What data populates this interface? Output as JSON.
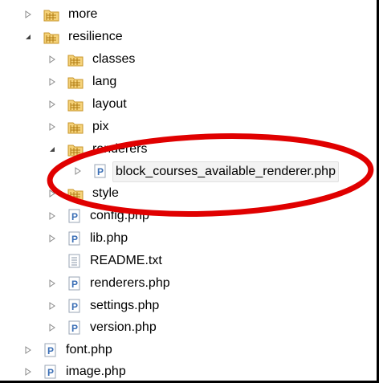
{
  "tree": {
    "items": [
      {
        "label": "more",
        "type": "folder",
        "expanded": false,
        "has_children": true
      },
      {
        "label": "resilience",
        "type": "folder",
        "expanded": true,
        "has_children": true
      },
      {
        "label": "classes",
        "type": "folder",
        "expanded": false,
        "has_children": true
      },
      {
        "label": "lang",
        "type": "folder",
        "expanded": false,
        "has_children": true
      },
      {
        "label": "layout",
        "type": "folder",
        "expanded": false,
        "has_children": true
      },
      {
        "label": "pix",
        "type": "folder",
        "expanded": false,
        "has_children": true
      },
      {
        "label": "renderers",
        "type": "folder",
        "expanded": true,
        "has_children": true
      },
      {
        "label": "block_courses_available_renderer.php",
        "type": "php",
        "expanded": false,
        "has_children": true,
        "selected": true
      },
      {
        "label": "style",
        "type": "folder",
        "expanded": false,
        "has_children": true
      },
      {
        "label": "config.php",
        "type": "php",
        "expanded": false,
        "has_children": true
      },
      {
        "label": "lib.php",
        "type": "php",
        "expanded": false,
        "has_children": true
      },
      {
        "label": "README.txt",
        "type": "text",
        "expanded": false,
        "has_children": false
      },
      {
        "label": "renderers.php",
        "type": "php",
        "expanded": false,
        "has_children": true
      },
      {
        "label": "settings.php",
        "type": "php",
        "expanded": false,
        "has_children": true
      },
      {
        "label": "version.php",
        "type": "php",
        "expanded": false,
        "has_children": true
      },
      {
        "label": "font.php",
        "type": "php",
        "expanded": false,
        "has_children": true
      },
      {
        "label": "image.php",
        "type": "php",
        "expanded": false,
        "has_children": true
      }
    ]
  },
  "colors": {
    "folder": "#e8b84a",
    "php_letter": "#3b6fb6",
    "annotation": "#e00000",
    "twisty": "#777777"
  },
  "icons": {
    "folder": "package-folder-icon",
    "php": "php-file-icon",
    "text": "text-file-icon",
    "collapsed": "chevron-right-icon",
    "expanded": "chevron-down-icon"
  }
}
